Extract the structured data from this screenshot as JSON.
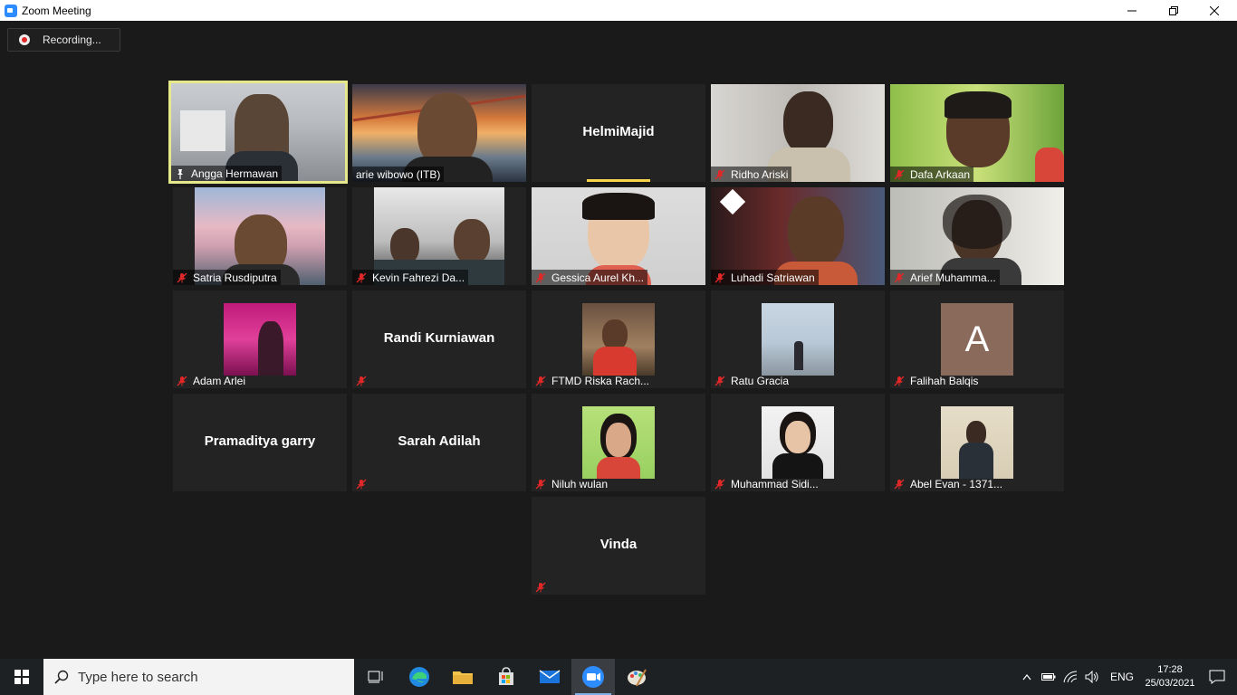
{
  "window": {
    "title": "Zoom Meeting"
  },
  "recording": {
    "label": "Recording..."
  },
  "participants": [
    {
      "name": "Angga Hermawan",
      "video": true,
      "muted": false,
      "active": true
    },
    {
      "name": "arie wibowo (ITB)",
      "video": true,
      "muted": false
    },
    {
      "name": "HelmiMajid",
      "video": false,
      "muted": false,
      "speaking": true
    },
    {
      "name": "Ridho Ariski",
      "video": true,
      "muted": true
    },
    {
      "name": "Dafa Arkaan",
      "video": true,
      "muted": true
    },
    {
      "name": "Satria Rusdiputra",
      "video": true,
      "muted": true
    },
    {
      "name": "Kevin Fahrezi Da...",
      "video": true,
      "muted": true
    },
    {
      "name": "Gessica Aurel Kh...",
      "video": true,
      "muted": true
    },
    {
      "name": "Luhadi Satriawan",
      "video": true,
      "muted": true
    },
    {
      "name": "Arief Muhamma...",
      "video": true,
      "muted": true
    },
    {
      "name": "Adam Arlei",
      "video": false,
      "photo": true,
      "muted": true
    },
    {
      "name": "Randi Kurniawan",
      "video": false,
      "muted": true
    },
    {
      "name": "FTMD Riska Rach...",
      "video": false,
      "photo": true,
      "muted": true
    },
    {
      "name": "Ratu Gracia",
      "video": false,
      "photo": true,
      "muted": true
    },
    {
      "name": "Falihah Balqis",
      "video": false,
      "avatar_letter": "A",
      "muted": true
    },
    {
      "name": "Pramaditya garry",
      "video": false,
      "muted": false
    },
    {
      "name": "Sarah Adilah",
      "video": false,
      "muted": true
    },
    {
      "name": "Niluh wulan",
      "video": false,
      "photo": true,
      "muted": true
    },
    {
      "name": "Muhammad Sidi...",
      "video": false,
      "photo": true,
      "muted": true
    },
    {
      "name": "Abel Evan - 1371...",
      "video": false,
      "photo": true,
      "muted": true
    },
    {
      "name": "Vinda",
      "video": false,
      "muted": true
    }
  ],
  "taskbar": {
    "search_placeholder": "Type here to search",
    "language": "ENG",
    "time": "17:28",
    "date": "25/03/2021"
  },
  "colors": {
    "background": "#1a1a1a",
    "tile": "#232323",
    "active_border": "#e6e98a",
    "mute_red": "#e02828"
  }
}
